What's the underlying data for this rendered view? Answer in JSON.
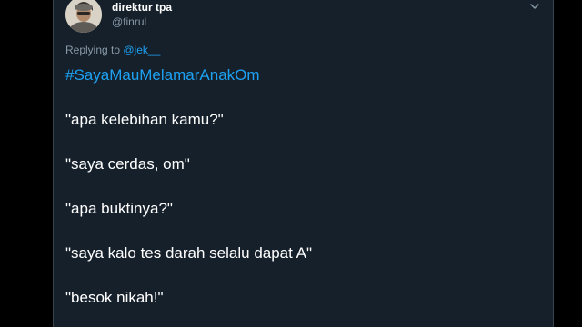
{
  "tweet": {
    "display_name": "direktur tpa",
    "handle": "@finrul",
    "replying_prefix": "Replying to ",
    "replying_to": "@jek__",
    "hashtag": "#SayaMauMelamarAnakOm",
    "lines": [
      "\"apa kelebihan kamu?\"",
      "\"saya cerdas, om\"",
      "\"apa buktinya?\"",
      "\"saya kalo tes darah selalu dapat A\"",
      "\"besok nikah!\""
    ]
  },
  "icons": {
    "menu_caret": "chevron-down-icon",
    "avatar": "avatar"
  },
  "colors": {
    "background": "#15202b",
    "outer": "#000000",
    "text": "#ffffff",
    "secondary": "#8899a6",
    "link": "#1da1f2",
    "border": "#38444d"
  }
}
